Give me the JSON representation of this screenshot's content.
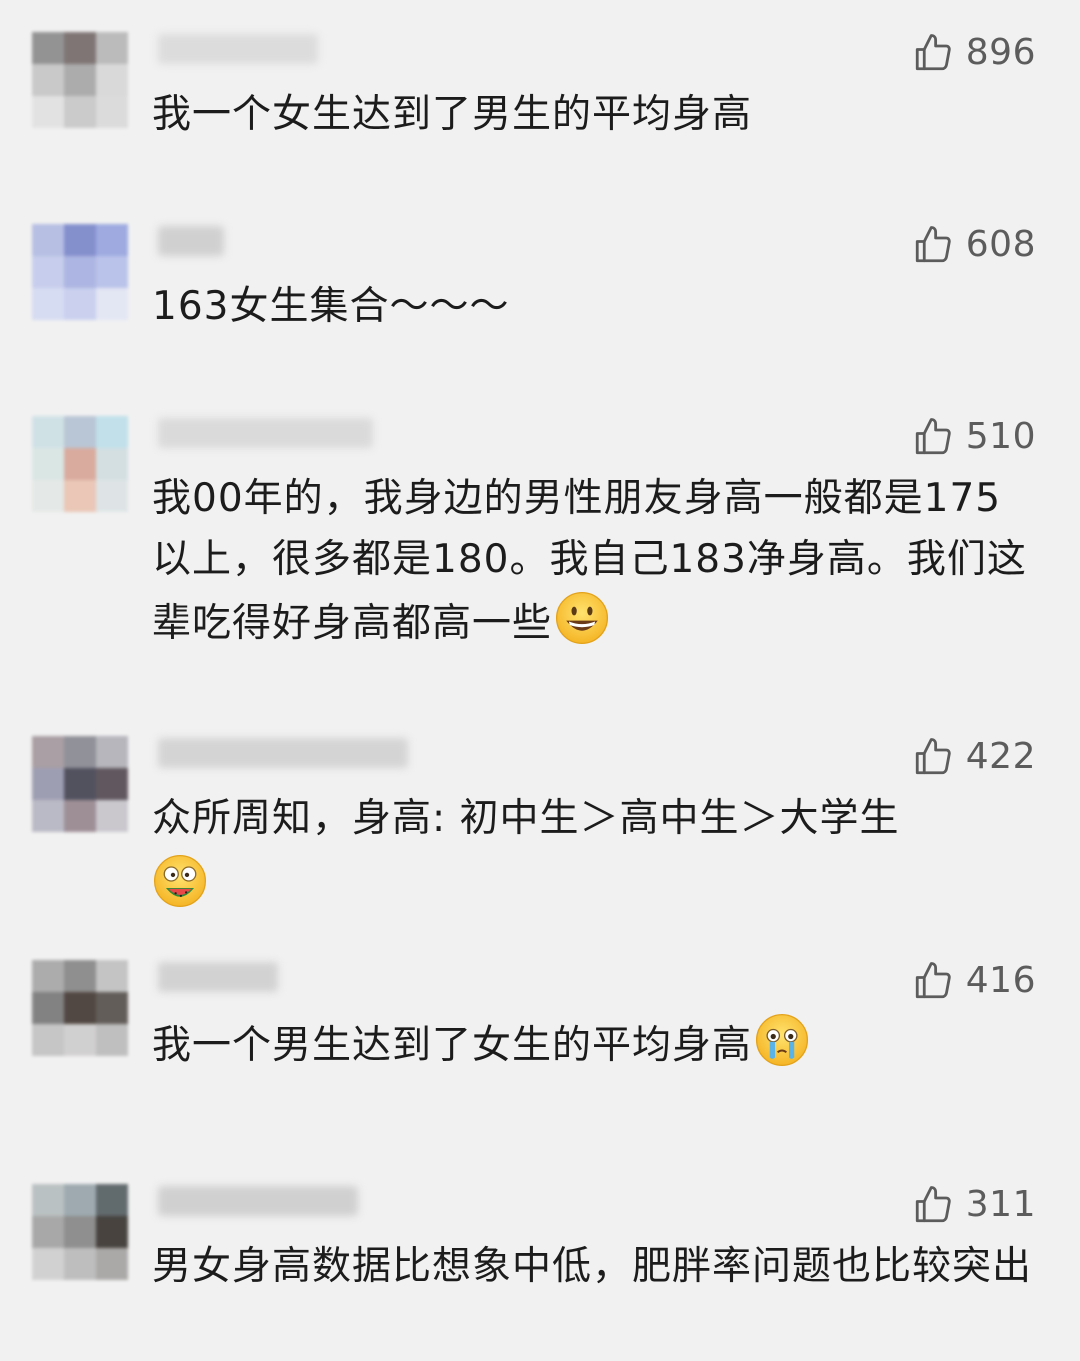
{
  "comments": [
    {
      "likes": "896",
      "text": "我一个女生达到了男生的平均身高",
      "emoji": ""
    },
    {
      "likes": "608",
      "text": "163女生集合～～～",
      "emoji": ""
    },
    {
      "likes": "510",
      "text": "我00年的，我身边的男性朋友身高一般都是175以上，很多都是180。我自己183净身高。我们这辈吃得好身高都高一些",
      "emoji": "grinning-face-emoji"
    },
    {
      "likes": "422",
      "text": "众所周知，身高: 初中生＞高中生＞大学生",
      "emoji": "watermelon-eating-face-emoji"
    },
    {
      "likes": "416",
      "text": "我一个男生达到了女生的平均身高",
      "emoji": "holding-back-tears-emoji"
    },
    {
      "likes": "311",
      "text": "男女身高数据比想象中低，肥胖率问题也比较突出",
      "emoji": ""
    }
  ],
  "icons": {
    "like": "thumbs-up-outline-icon"
  },
  "colors": {
    "background": "#f1f1f1",
    "text": "#1c1c1c",
    "like": "#5c5c5c"
  }
}
